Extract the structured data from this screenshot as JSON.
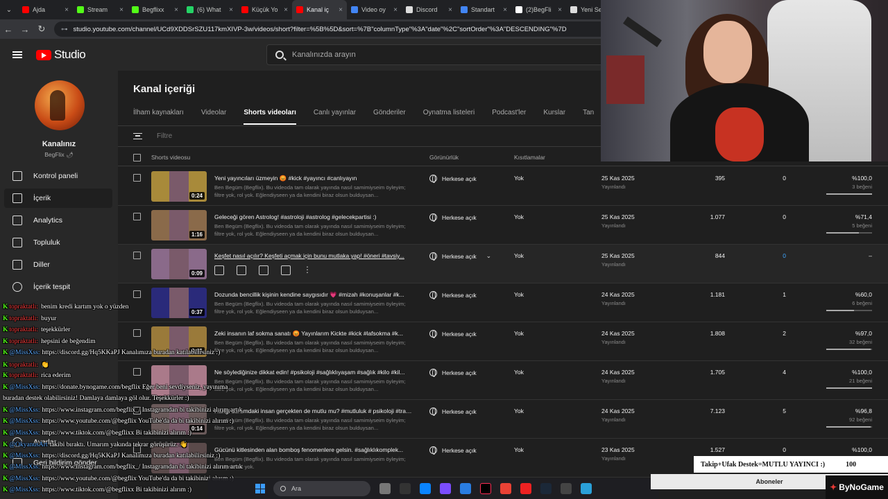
{
  "browser": {
    "tabs": [
      {
        "label": "Ajda",
        "color": "#ff0000"
      },
      {
        "label": "Stream",
        "color": "#53fc18"
      },
      {
        "label": "Begflixx",
        "color": "#53fc18"
      },
      {
        "label": "(6) What",
        "color": "#25d366"
      },
      {
        "label": "Küçük Yo",
        "color": "#ff0000"
      },
      {
        "label": "Kanal iç",
        "color": "#ff0000"
      },
      {
        "label": "Video oy",
        "color": "#4285f4"
      },
      {
        "label": "Discord",
        "color": "#dddddd"
      },
      {
        "label": "Standart",
        "color": "#4285f4"
      },
      {
        "label": "(2)BegFli",
        "color": "#ffffff"
      },
      {
        "label": "Yeni Se",
        "color": "#dddddd"
      }
    ],
    "active_tab_index": 5,
    "url": "studio.youtube.com/channel/UCd9XDDSrSZU117kmXIVP-3w/videos/short?filter=%5B%5D&sort=%7B\"columnType\"%3A\"date\"%2C\"sortOrder\"%3A\"DESCENDING\"%7D"
  },
  "header": {
    "logo_text": "Studio",
    "search_placeholder": "Kanalınızda arayın"
  },
  "sidebar": {
    "channel_name": "Kanalınız",
    "channel_sub": "BegFlix 🌶",
    "items": [
      {
        "label": "Kontrol paneli",
        "icon": "dashboard-icon"
      },
      {
        "label": "İçerik",
        "icon": "content-icon",
        "active": true
      },
      {
        "label": "Analytics",
        "icon": "analytics-icon"
      },
      {
        "label": "Topluluk",
        "icon": "community-icon"
      },
      {
        "label": "Diller",
        "icon": "languages-icon"
      },
      {
        "label": "İçerik tespit",
        "icon": "copyright-icon"
      }
    ],
    "bottom_items": [
      {
        "label": "Ayarlar"
      },
      {
        "label": "Geri bildirim gönder"
      }
    ]
  },
  "main": {
    "title": "Kanal içeriği",
    "tabs": [
      "İlham kaynakları",
      "Videolar",
      "Shorts videoları",
      "Canlı yayınlar",
      "Gönderiler",
      "Oynatma listeleri",
      "Podcast'ler",
      "Kurslar",
      "Tan"
    ],
    "active_tab": 2,
    "filter_placeholder": "Filtre",
    "columns": {
      "video": "Shorts videosu",
      "visibility": "Görünürlük",
      "restrictions": "Kısıtlamalar"
    },
    "rows": [
      {
        "title": "Yeni yayıncıları üzmeyin 😡 #kick #yayıncı #canlıyayın",
        "desc": "Ben Begüm (Begflix). Bu videoda tam olarak yayında nasıl samimiyseim öyleyim; filtre yok, rol yok. Eğlendiyseen ya da kendini biraz olsun bulduysan...",
        "duration": "0:24",
        "visibility": "Herkese açık",
        "restriction": "Yok",
        "date": "25 Kas 2025",
        "date_sub": "Yayınlandı",
        "views": "395",
        "comments": "0",
        "likes": "%100,0",
        "likes_sub": "3 beğeni",
        "like_ratio": 1.0,
        "thumb": "#a88a3a"
      },
      {
        "title": "Geleceği gören Astrolog! #astroloji #astrolog #gelecekpartisi :)",
        "desc": "Ben Begüm (Begflix). Bu videoda tam olarak yayında nasıl samimiyseim öyleyim; filtre yok, rol yok. Eğlendiyseen ya da kendini biraz olsun bulduysan...",
        "duration": "1:16",
        "visibility": "Herkese açık",
        "restriction": "Yok",
        "date": "25 Kas 2025",
        "date_sub": "Yayınlandı",
        "views": "1.077",
        "comments": "0",
        "likes": "%71,4",
        "likes_sub": "5 beğeni",
        "like_ratio": 0.714,
        "thumb": "#8a6a4a"
      },
      {
        "title": "Keşfet nasıl açılır? Keşfeti açmak için bunu mutlaka yap! #öneri #tavsiy...",
        "desc": "",
        "duration": "0:09",
        "visibility": "Herkese açık",
        "restriction": "Yok",
        "date": "25 Kas 2025",
        "date_sub": "Yayınlandı",
        "views": "844",
        "comments": "0",
        "likes": "–",
        "likes_sub": "",
        "like_ratio": null,
        "hover": true,
        "thumb": "#8a6a8a"
      },
      {
        "title": "Dozunda bencillik kişinin kendine saygısıdır 💗 #mizah #konuşanlar #k...",
        "desc": "Ben Begüm (Begflix). Bu videoda tam olarak yayında nasıl samimiyseim öyleyim; filtre yok, rol yok. Eğlendiyseen ya da kendini biraz olsun bulduysan...",
        "duration": "0:37",
        "visibility": "Herkese açık",
        "restriction": "Yok",
        "date": "24 Kas 2025",
        "date_sub": "Yayınlandı",
        "views": "1.181",
        "comments": "1",
        "likes": "%60,0",
        "likes_sub": "6 beğeni",
        "like_ratio": 0.6,
        "thumb": "#2a2a7a"
      },
      {
        "title": "Zeki insanın laf sokma sanatı 😡 Yayınlarım Kickte #kick #lafsokma #k...",
        "desc": "Ben Begüm (Begflix). Bu videoda tam olarak yayında nasıl samimiyseim öyleyim; filtre yok, rol yok. Eğlendiyseen ya da kendini biraz olsun bulduysan...",
        "duration": "0:31",
        "visibility": "Herkese açık",
        "restriction": "Yok",
        "date": "24 Kas 2025",
        "date_sub": "Yayınlandı",
        "views": "1.808",
        "comments": "2",
        "likes": "%97,0",
        "likes_sub": "32 beğeni",
        "like_ratio": 0.97,
        "thumb": "#9a7a3a"
      },
      {
        "title": "Ne söylediğinize dikkat edin! #psikoloji #sağlıklıyaşam #sağlık #kilo #kil...",
        "desc": "Ben Begüm (Begflix). Bu videoda tam olarak yayında nasıl samimiyseim öyleyim; filtre yok, rol yok. Eğlendiyseen ya da kendini biraz olsun bulduysan...",
        "duration": "",
        "visibility": "Herkese açık",
        "restriction": "Yok",
        "date": "24 Kas 2025",
        "date_sub": "Yayınlandı",
        "views": "1.705",
        "comments": "4",
        "likes": "%100,0",
        "likes_sub": "21 beğeni",
        "like_ratio": 1.0,
        "thumb": "#aa7a8a"
      },
      {
        "title": "Hangi durumdaki insan gerçekten de mutlu mu? #mutluluk # psikoloji #trav...",
        "desc": "Ben Begüm (Begflix). Bu videoda tam olarak yayında nasıl samimiyseim öyleyim; filtre yok, rol yok. Eğlendiyseen ya da kendini biraz olsun bulduysan...",
        "duration": "0:14",
        "visibility": "Herkese açık",
        "restriction": "Yok",
        "date": "24 Kas 2025",
        "date_sub": "Yayınlandı",
        "views": "7.123",
        "comments": "5",
        "likes": "%96,8",
        "likes_sub": "92 beğeni",
        "like_ratio": 0.968,
        "thumb": "#6a5a5a"
      },
      {
        "title": "Gücünü kitlesinden alan bomboş fenomenlere gelsin. #sağlıklıkomplek...",
        "desc": "Ben Begüm (Begflix). Bu videoda tam olarak yayında nasıl samimiyseim öyleyim; filtre yok, rol yok.",
        "duration": "",
        "visibility": "Herkese açık",
        "restriction": "Yok",
        "date": "23 Kas 2025",
        "date_sub": "Yayınlandı",
        "views": "1.527",
        "comments": "0",
        "likes": "%100,0",
        "likes_sub": "",
        "like_ratio": 1.0,
        "thumb": "#5a4a4a"
      }
    ]
  },
  "chat": [
    {
      "user": "topraktatlı:",
      "text": "benim kredi kartım yok o yüzden"
    },
    {
      "user": "topraktatlı:",
      "text": "buyur"
    },
    {
      "user": "topraktatlı:",
      "text": "teşekkürler"
    },
    {
      "user": "topraktatlı:",
      "text": "hepsini de beğendim"
    },
    {
      "mention": "@MissXss:",
      "text": "https://discord.gg/Hq5KKaPJ Kanalımıza buradan katılabilirsiniz :)"
    },
    {
      "user": "topraktatlı:",
      "text": "👏"
    },
    {
      "user": "topraktatlı:",
      "text": "rica ederim"
    },
    {
      "mention": "@MissXss:",
      "text": "https://donate.bynogame.com/begflix Eğer beni sevdiyseniz, yayınıma"
    },
    {
      "plain": "buradan destek olabilirsiniz! Damlaya damlaya göl olur. Teşekkürler :)"
    },
    {
      "mention": "@MissXss:",
      "text": "https://www.instagram.com/begflix_/ Instagramdan bi takibinizi alırım artık"
    },
    {
      "mention": "@MissXss:",
      "text": "https://www.youtube.com/@begflix YouTube'da da bi takibinizi alırım :)"
    },
    {
      "mention": "@MissXss:",
      "text": "https://www.tiktok.com/@begflixx Bi takibinizi alırım :)"
    },
    {
      "mention": "@OkyanusArt",
      "text": "takibi bıraktı. Umarım yakında tekrar görüşürüz. 👋"
    },
    {
      "mention": "@MissXss:",
      "text": "https://discord.gg/Hq5KKaPJ Kanalımıza buradan katılabilirsiniz :)"
    },
    {
      "mention": "@MissXss:",
      "text": "https://www.instagram.com/begflix_/ Instagramdan bi takibinizi alırım artık"
    },
    {
      "mention": "@MissXss:",
      "text": "https://www.youtube.com/@begflix YouTube'da da bi takibinizi alırım :)"
    },
    {
      "mention": "@MissXss:",
      "text": "https://www.tiktok.com/@begflixx Bi takibinizi alırım :)"
    }
  ],
  "overlay": {
    "goal_text": "Takip+Ufak Destek=MUTLU YAYINCI :)",
    "goal_count": "100",
    "subs_label": "Aboneler",
    "brand": "ByNoGame"
  },
  "taskbar": {
    "search_label": "Ara"
  }
}
